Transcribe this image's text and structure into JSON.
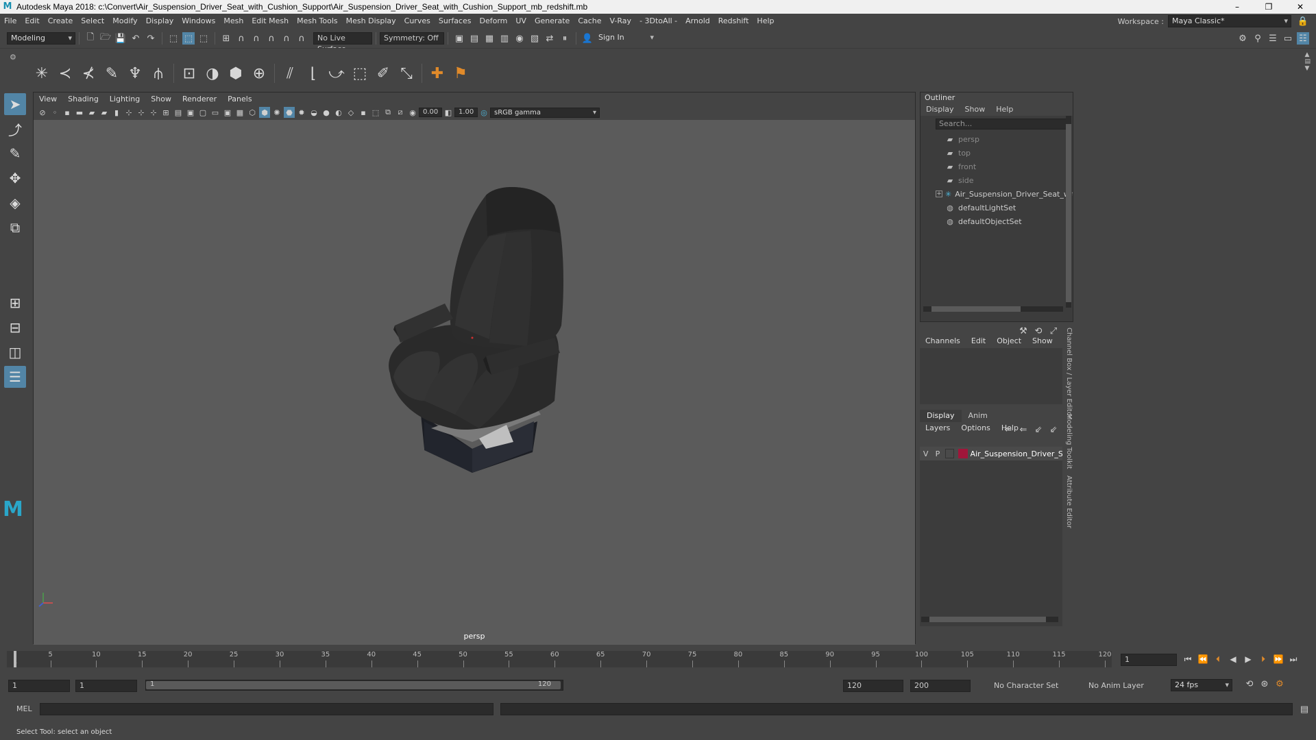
{
  "window": {
    "title": "Autodesk Maya 2018: c:\\Convert\\Air_Suspension_Driver_Seat_with_Cushion_Support\\Air_Suspension_Driver_Seat_with_Cushion_Support_mb_redshift.mb",
    "controls": [
      "–",
      "❐",
      "✕"
    ]
  },
  "menubar": {
    "items": [
      "File",
      "Edit",
      "Create",
      "Select",
      "Modify",
      "Display",
      "Windows",
      "Mesh",
      "Edit Mesh",
      "Mesh Tools",
      "Mesh Display",
      "Curves",
      "Surfaces",
      "Deform",
      "UV",
      "Generate",
      "Cache",
      "V-Ray",
      "- 3DtoAll -",
      "Arnold",
      "Redshift",
      "Help"
    ],
    "workspace_label": "Workspace :",
    "workspace_value": "Maya Classic*"
  },
  "statusline": {
    "mode": "Modeling",
    "live_surface": "No Live Surface",
    "symmetry": "Symmetry: Off",
    "sign_in": "Sign In"
  },
  "viewport": {
    "menu": [
      "View",
      "Shading",
      "Lighting",
      "Show",
      "Renderer",
      "Panels"
    ],
    "exposure": "0.00",
    "gamma": "1.00",
    "color_space": "sRGB gamma",
    "camera": "persp"
  },
  "outliner": {
    "title": "Outliner",
    "menu": [
      "Display",
      "Show",
      "Help"
    ],
    "search_placeholder": "Search...",
    "items": [
      {
        "label": "persp",
        "icon": "camera-icon"
      },
      {
        "label": "top",
        "icon": "camera-icon"
      },
      {
        "label": "front",
        "icon": "camera-icon"
      },
      {
        "label": "side",
        "icon": "camera-icon"
      },
      {
        "label": "Air_Suspension_Driver_Seat_with_Cushi",
        "icon": "group-icon"
      },
      {
        "label": "defaultLightSet",
        "icon": "set-icon"
      },
      {
        "label": "defaultObjectSet",
        "icon": "set-icon"
      }
    ]
  },
  "channelbox": {
    "menu": [
      "Channels",
      "Edit",
      "Object",
      "Show"
    ],
    "tabs": [
      "Display",
      "Anim"
    ],
    "layer_menu": [
      "Layers",
      "Options",
      "Help"
    ],
    "layer": {
      "v": "V",
      "p": "P",
      "name": "Air_Suspension_Driver_Seat_wit",
      "color": "#a0163a"
    },
    "side_tabs": [
      "Channel Box / Layer Editor",
      "Modeling Toolkit",
      "Attribute Editor"
    ]
  },
  "timeslider": {
    "ticks": [
      "1",
      "5",
      "10",
      "15",
      "20",
      "25",
      "30",
      "35",
      "40",
      "45",
      "50",
      "55",
      "60",
      "65",
      "70",
      "75",
      "80",
      "85",
      "90",
      "95",
      "100",
      "105",
      "110",
      "115",
      "120"
    ],
    "current_frame": "1"
  },
  "rangeslider": {
    "start": "1",
    "inner_start": "1",
    "range_start_label": "1",
    "range_end_label": "120",
    "end": "120",
    "anim_end": "200",
    "character_set": "No Character Set",
    "anim_layer": "No Anim Layer",
    "fps": "24 fps"
  },
  "cmdline": {
    "lang": "MEL"
  },
  "helpline": {
    "text": "Select Tool: select an object"
  },
  "colors": {
    "accent": "#5285a6",
    "background": "#444444",
    "viewport": "#5b5b5b"
  }
}
